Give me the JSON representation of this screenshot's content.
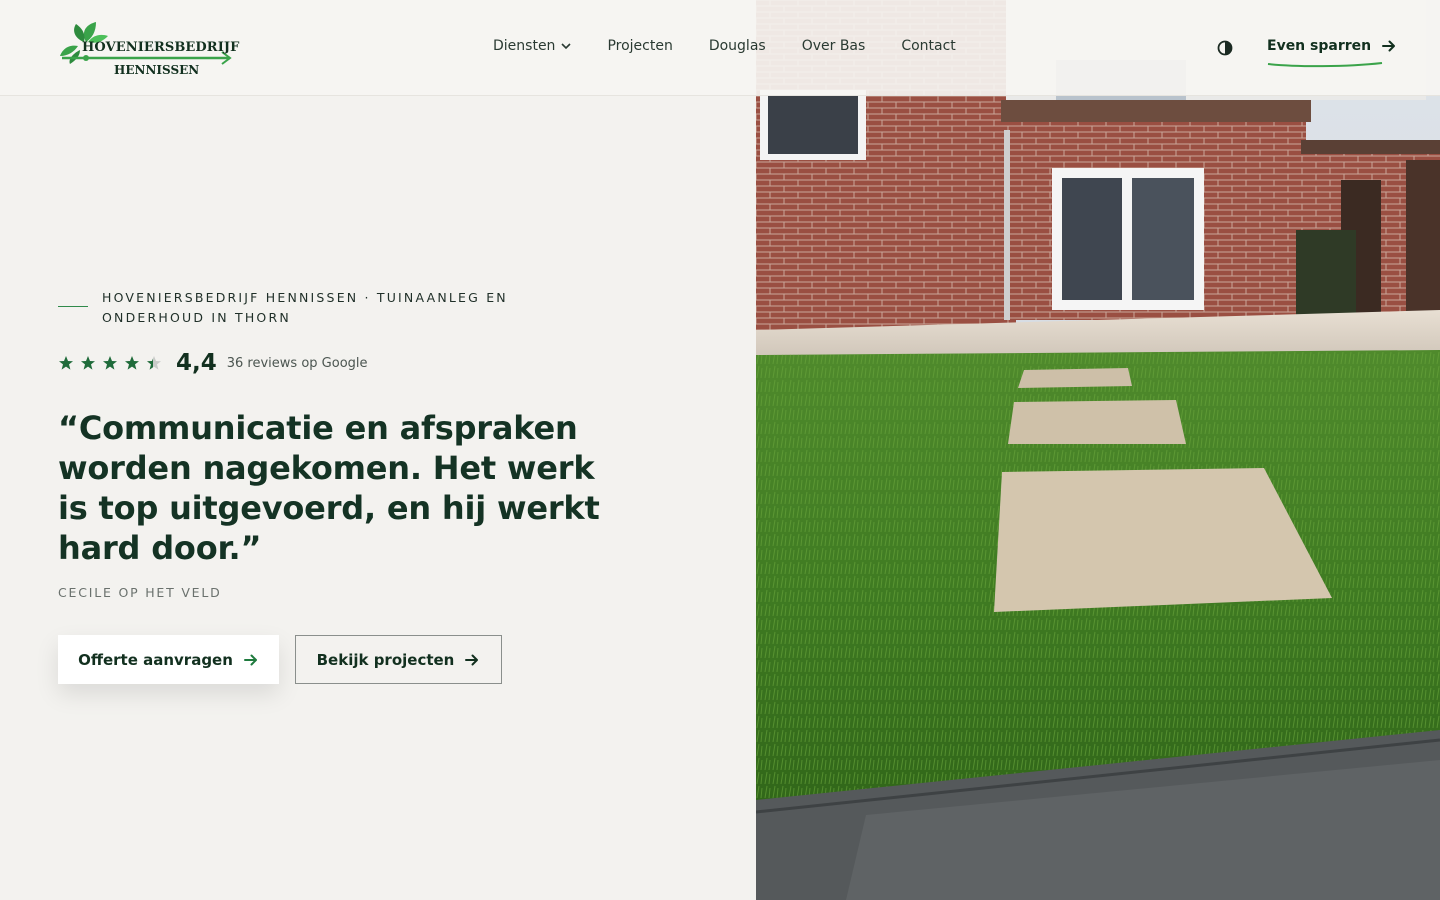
{
  "brand": {
    "name_line1": "HOVENIERSBEDRIJF",
    "name_line2": "HENNISSEN",
    "accent": "#3aa34a",
    "dark": "#12301f"
  },
  "nav": {
    "items": [
      {
        "label": "Diensten",
        "dropdown": true
      },
      {
        "label": "Projecten"
      },
      {
        "label": "Douglas"
      },
      {
        "label": "Over Bas"
      },
      {
        "label": "Contact"
      }
    ],
    "theme_toggle_icon": "contrast-icon",
    "cta_label": "Even sparren"
  },
  "hero": {
    "eyebrow": "HOVENIERSBEDRIJF HENNISSEN · TUINAANLEG EN ONDERHOUD IN THORN",
    "rating": {
      "value": "4,4",
      "stars": 4.4,
      "text": "36 reviews op Google",
      "star_color": "#1f6b3a"
    },
    "quote": "“Communicatie en afspraken worden nagekomen. Het werk is top uitgevoerd, en hij werkt hard door.”",
    "author": "CECILE OP HET VELD",
    "primary_button": "Offerte aanvragen",
    "secondary_button": "Bekijk projecten"
  }
}
